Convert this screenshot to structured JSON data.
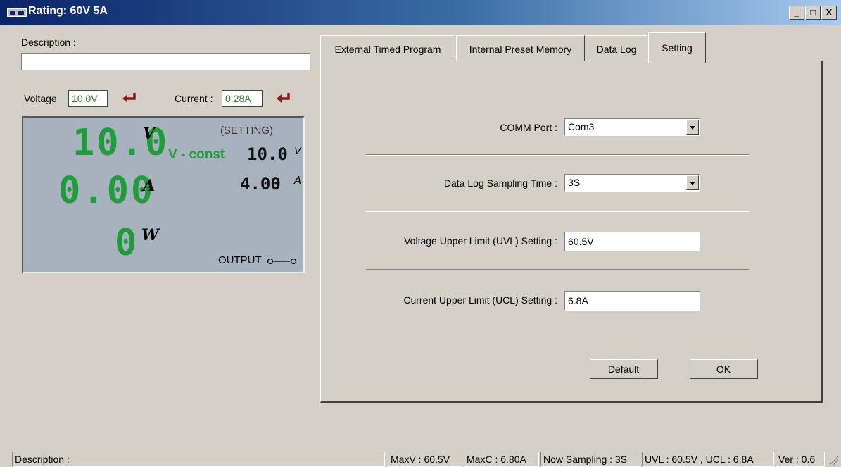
{
  "window": {
    "title": "Rating: 60V 5A",
    "controls": {
      "minimize": "_",
      "maximize": "□",
      "close": "X"
    }
  },
  "left": {
    "description_label": "Description :",
    "description_value": "",
    "voltage_label": "Voltage",
    "voltage_value": "10.0V",
    "current_label": "Current :",
    "current_value": "0.28A",
    "enter_icon_color": "#8b1a1a"
  },
  "display": {
    "volt_reading": "10.0",
    "volt_unit": "V",
    "amp_reading": "0.00",
    "amp_unit": "A",
    "watt_reading": "0",
    "watt_unit": "W",
    "setting_label": "(SETTING)",
    "mode": "V - const",
    "set_volt": "10.0",
    "set_volt_unit": "V",
    "set_amp": "4.00",
    "set_amp_unit": "A",
    "output_label": "OUTPUT",
    "segment_color": "#1f9d3a",
    "lcd_background": "#a8b2be"
  },
  "tabs": [
    {
      "label": "External Timed Program",
      "active": false
    },
    {
      "label": "Internal Preset Memory",
      "active": false
    },
    {
      "label": "Data Log",
      "active": false
    },
    {
      "label": "Setting",
      "active": true
    }
  ],
  "setting": {
    "comm_port_label": "COMM Port :",
    "comm_port_value": "Com3",
    "sampling_label": "Data Log Sampling Time :",
    "sampling_value": "3S",
    "uvl_label": "Voltage Upper Limit (UVL) Setting :",
    "uvl_value": "60.5V",
    "ucl_label": "Current Upper Limit (UCL) Setting :",
    "ucl_value": "6.8A",
    "default_button": "Default",
    "ok_button": "OK"
  },
  "statusbar": {
    "description": "Description :",
    "maxv": "MaxV : 60.5V",
    "maxc": "MaxC : 6.80A",
    "sampling": "Now Sampling : 3S",
    "limits": "UVL : 60.5V , UCL : 6.8A",
    "version": "Ver : 0.6"
  }
}
